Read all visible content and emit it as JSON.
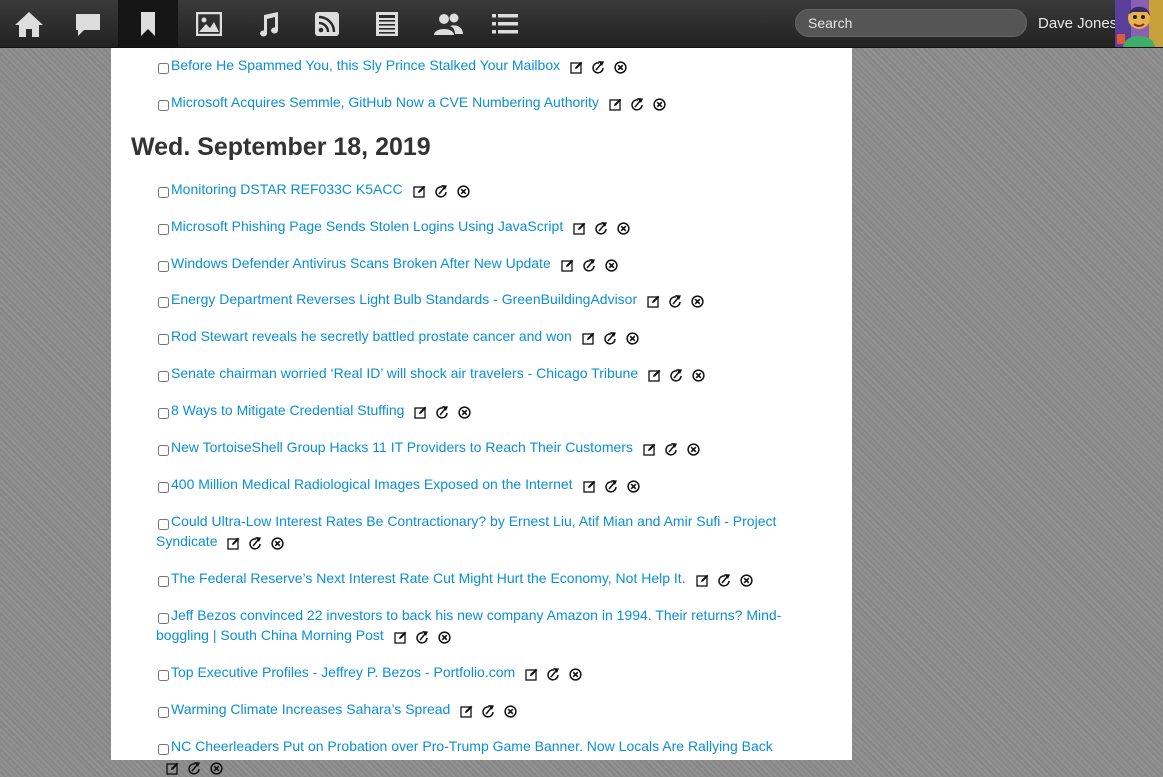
{
  "nav": {
    "icons": [
      "home-icon",
      "chat-bubble-icon",
      "bookmark-icon",
      "image-icon",
      "music-note-icon",
      "rss-icon",
      "newspaper-icon",
      "people-icon",
      "list-icon"
    ],
    "active": "bookmark-icon"
  },
  "search": {
    "placeholder": "Search",
    "value": ""
  },
  "user": {
    "name": "Dave Jones"
  },
  "colors": {
    "link": "#0a8fd6",
    "heading": "#333333",
    "topbar": "#2b2b2b"
  },
  "pre_items": [
    {
      "title": "Before He Spammed You, this Sly Prince Stalked Your Mailbox"
    },
    {
      "title": "Microsoft Acquires Semmle, GitHub Now a CVE Numbering Authority"
    }
  ],
  "day_heading": "Wed. September 18, 2019",
  "items": [
    {
      "title": "Monitoring DSTAR REF033C K5ACC"
    },
    {
      "title": "Microsoft Phishing Page Sends Stolen Logins Using JavaScript"
    },
    {
      "title": "Windows Defender Antivirus Scans Broken After New Update"
    },
    {
      "title": "Energy Department Reverses Light Bulb Standards - GreenBuildingAdvisor"
    },
    {
      "title": "Rod Stewart reveals he secretly battled prostate cancer and won"
    },
    {
      "title": "Senate chairman worried ‘Real ID’ will shock air travelers - Chicago Tribune"
    },
    {
      "title": "8 Ways to Mitigate Credential Stuffing"
    },
    {
      "title": "New TortoiseShell Group Hacks 11 IT Providers to Reach Their Customers"
    },
    {
      "title": "400 Million Medical Radiological Images Exposed on the Internet"
    },
    {
      "title": "Could Ultra-Low Interest Rates Be Contractionary? by Ernest Liu, Atif Mian and Amir Sufi - Project Syndicate"
    },
    {
      "title": "The Federal Reserve’s Next Interest Rate Cut Might Hurt the Economy, Not Help It."
    },
    {
      "title": "Jeff Bezos convinced 22 investors to back his new company Amazon in 1994. Their returns? Mind-boggling | South China Morning Post"
    },
    {
      "title": "Top Executive Profiles - Jeffrey P. Bezos - Portfolio.com"
    },
    {
      "title": "Warming Climate Increases Sahara’s Spread"
    },
    {
      "title": "NC Cheerleaders Put on Probation over Pro-Trump Game Banner. Now Locals Are Rallying Back"
    }
  ]
}
